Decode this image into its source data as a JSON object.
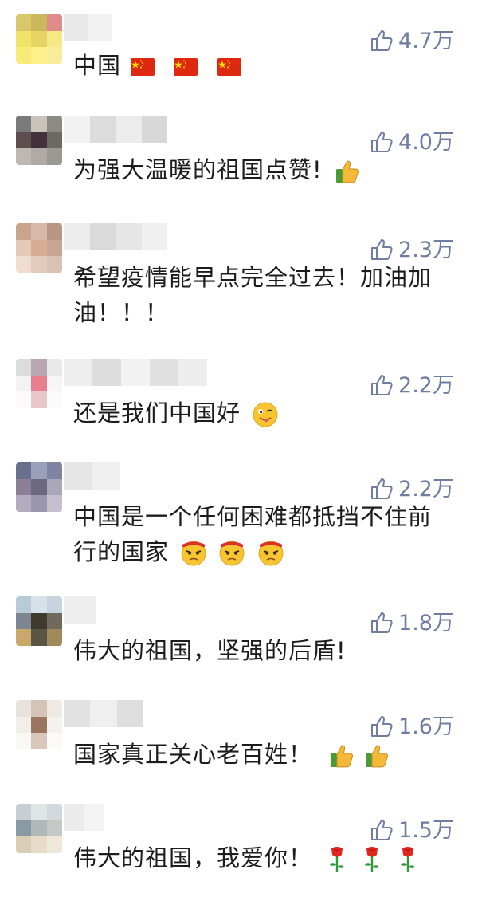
{
  "comments": [
    {
      "likes": "4.7万",
      "text": "中国",
      "emojis": [
        "flag-cn-icon",
        "flag-cn-icon",
        "flag-cn-icon"
      ]
    },
    {
      "likes": "4.0万",
      "text": "为强大温暖的祖国点赞!",
      "emojis": [
        "thumbs-up-icon"
      ]
    },
    {
      "likes": "2.3万",
      "text": "希望疫情能早点完全过去！加油加油！！！",
      "emojis": []
    },
    {
      "likes": "2.2万",
      "text": "还是我们中国好",
      "emojis": [
        "winking-tongue-face-icon"
      ]
    },
    {
      "likes": "2.2万",
      "text": "中国是一个任何困难都抵挡不住前行的国家",
      "emojis": [
        "determined-face-icon",
        "determined-face-icon",
        "determined-face-icon"
      ]
    },
    {
      "likes": "1.8万",
      "text": "伟大的祖国，坚强的后盾!",
      "emojis": []
    },
    {
      "likes": "1.6万",
      "text": "国家真正关心老百姓！",
      "emojis": [
        "thumbs-up-icon",
        "thumbs-up-icon"
      ]
    },
    {
      "likes": "1.5万",
      "text": "伟大的祖国，我爱你！",
      "emojis": [
        "rose-icon",
        "rose-icon",
        "rose-icon"
      ]
    }
  ],
  "colors": {
    "like_text": "#6e7da0",
    "comment_text": "#1c1c1c",
    "flag_red": "#de2910",
    "flag_yellow": "#ffde00",
    "emoji_yellow": "#f7c531",
    "rose_red": "#e0261f",
    "stem_green": "#2e9a3a"
  }
}
